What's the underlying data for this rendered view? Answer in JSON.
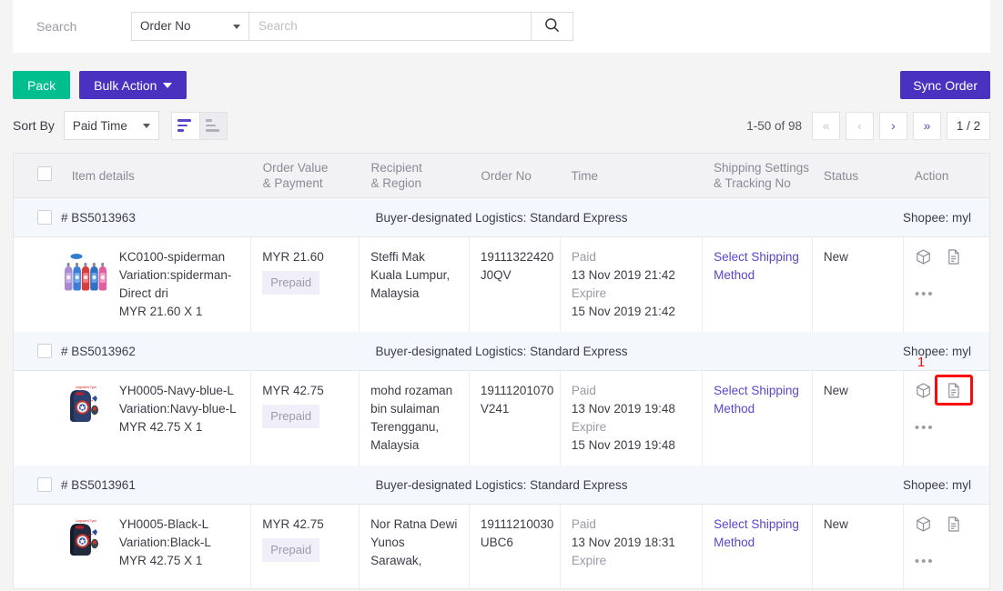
{
  "search": {
    "label": "Search",
    "select_value": "Order No",
    "placeholder": "Search",
    "input_value": "",
    "search_icon": "search-icon"
  },
  "toolbar": {
    "pack_label": "Pack",
    "bulk_action_label": "Bulk Action",
    "sync_order_label": "Sync Order",
    "pack_color": "#00bf8f",
    "bulk_color": "#4a31bf",
    "sync_color": "#4a31bf"
  },
  "sort": {
    "label": "Sort By",
    "value": "Paid Time",
    "desc_icon": "sort-descending-icon",
    "asc_icon": "sort-ascending-icon"
  },
  "pagination": {
    "count_text": "1-50 of 98",
    "first_label": "«",
    "prev_label": "‹",
    "next_label": "›",
    "last_label": "»",
    "page_text": "1 / 2"
  },
  "table": {
    "headers": {
      "item": "Item details",
      "value": "Order Value\n& Payment",
      "value_l1": "Order Value",
      "value_l2": "& Payment",
      "recipient_l1": "Recipient",
      "recipient_l2": "& Region",
      "order_no": "Order No",
      "time": "Time",
      "shipping_l1": "Shipping Settings",
      "shipping_l2": "& Tracking No",
      "status": "Status",
      "action": "Action"
    },
    "orders": [
      {
        "order_id": "# BS5013963",
        "logistics": "Buyer-designated Logistics: Standard Express",
        "shop": "Shopee: myl",
        "thumb": "water-bottles-thumbnail",
        "item_name": "KC0100-spiderman",
        "item_variation": "Variation:spiderman-Direct dri",
        "item_price_qty": "MYR 21.60 X 1",
        "order_value": "MYR 21.60",
        "payment_badge": "Prepaid",
        "recipient_name": "Steffi Mak",
        "recipient_region1": "Kuala Lumpur,",
        "recipient_region2": "Malaysia",
        "order_no_l1": "19111322420",
        "order_no_l2": "J0QV",
        "paid_label": "Paid",
        "paid_time": "13 Nov 2019 21:42",
        "expire_label": "Expire",
        "expire_time": "15 Nov 2019 21:42",
        "shipping_link": "Select Shipping Method",
        "status": "New",
        "box_icon": "package-box-icon",
        "doc_icon": "document-icon",
        "more_icon": "more-options-icon",
        "highlighted": false,
        "highlight_number": ""
      },
      {
        "order_id": "# BS5013962",
        "logistics": "Buyer-designated Logistics: Standard Express",
        "shop": "Shopee: myl",
        "thumb": "navy-backpack-thumbnail",
        "item_name": "YH0005-Navy-blue-L",
        "item_variation": "Variation:Navy-blue-L",
        "item_price_qty": "MYR 42.75 X 1",
        "order_value": "MYR 42.75",
        "payment_badge": "Prepaid",
        "recipient_name": "mohd rozaman bin sulaiman",
        "recipient_region1": "Terengganu,",
        "recipient_region2": "Malaysia",
        "order_no_l1": "19111201070",
        "order_no_l2": "V241",
        "paid_label": "Paid",
        "paid_time": "13 Nov 2019 19:48",
        "expire_label": "Expire",
        "expire_time": "15 Nov 2019 19:48",
        "shipping_link": "Select Shipping Method",
        "status": "New",
        "box_icon": "package-box-icon",
        "doc_icon": "document-icon",
        "more_icon": "more-options-icon",
        "highlighted": true,
        "highlight_number": "1"
      },
      {
        "order_id": "# BS5013961",
        "logistics": "Buyer-designated Logistics: Standard Express",
        "shop": "Shopee: myl",
        "thumb": "black-backpack-thumbnail",
        "item_name": "YH0005-Black-L",
        "item_variation": "Variation:Black-L",
        "item_price_qty": "MYR 42.75 X 1",
        "order_value": "MYR 42.75",
        "payment_badge": "Prepaid",
        "recipient_name": "Nor Ratna Dewi Yunos",
        "recipient_region1": "Sarawak,",
        "recipient_region2": "",
        "order_no_l1": "19111210030",
        "order_no_l2": "UBC6",
        "paid_label": "Paid",
        "paid_time": "13 Nov 2019 18:31",
        "expire_label": "Expire",
        "expire_time": "",
        "shipping_link": "Select Shipping Method",
        "status": "New",
        "box_icon": "package-box-icon",
        "doc_icon": "document-icon",
        "more_icon": "more-options-icon",
        "highlighted": false,
        "highlight_number": ""
      }
    ]
  },
  "colors": {
    "accent_purple": "#5b45cc",
    "green": "#00bf8f",
    "highlight_red": "#fb0b0b",
    "page_bg": "#f4f4f5",
    "row_header_bg": "#f4f8fd"
  }
}
